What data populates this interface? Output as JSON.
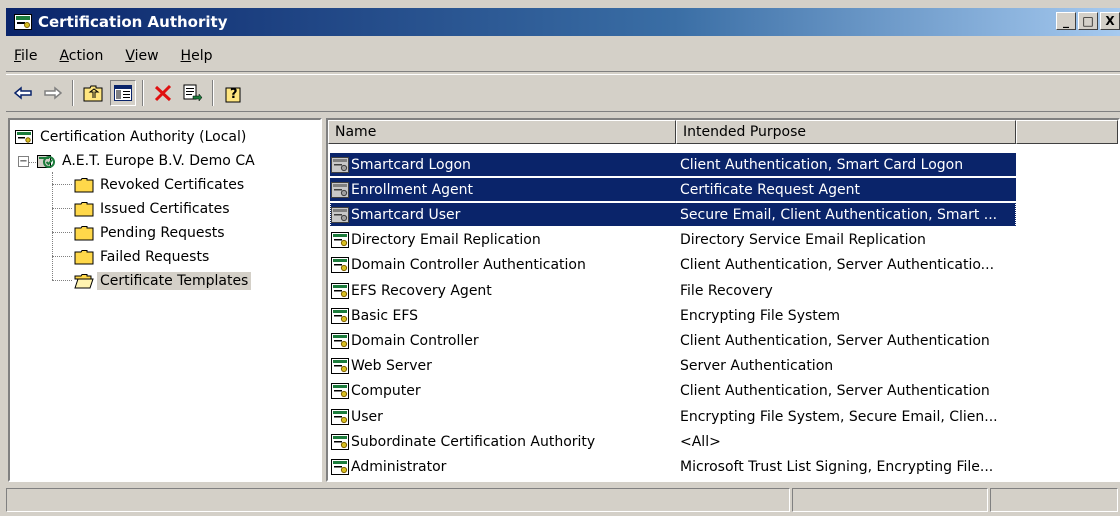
{
  "window": {
    "title": "Certification Authority",
    "caption": {
      "minimize": "_",
      "maximize": "□",
      "close": "X"
    }
  },
  "menu": [
    {
      "accel": "F",
      "rest": "ile"
    },
    {
      "accel": "A",
      "rest": "ction"
    },
    {
      "accel": "V",
      "rest": "iew"
    },
    {
      "accel": "H",
      "rest": "elp"
    }
  ],
  "toolbar": {
    "buttons": [
      "back-arrow-icon",
      "forward-arrow-icon",
      "up-one-level-icon",
      "show-hide-console-tree-icon",
      "delete-icon",
      "export-list-icon",
      "help-icon"
    ]
  },
  "tree": {
    "root": "Certification Authority (Local)",
    "ca": "A.E.T. Europe B.V. Demo CA",
    "folders": [
      "Revoked Certificates",
      "Issued Certificates",
      "Pending Requests",
      "Failed Requests",
      "Certificate Templates"
    ],
    "selected_folder": "Certificate Templates"
  },
  "list": {
    "columns": [
      "Name",
      "Intended Purpose"
    ],
    "rows": [
      {
        "name": "Smartcard Logon",
        "purpose": "Client Authentication, Smart Card Logon",
        "selected": true,
        "icon": "template-icon-grey"
      },
      {
        "name": "Enrollment Agent",
        "purpose": "Certificate Request Agent",
        "selected": true,
        "icon": "template-icon-grey"
      },
      {
        "name": "Smartcard User",
        "purpose": "Secure Email, Client Authentication, Smart ...",
        "selected": true,
        "focused": true,
        "icon": "template-icon-grey"
      },
      {
        "name": "Directory Email Replication",
        "purpose": "Directory Service Email Replication",
        "icon": "template-icon"
      },
      {
        "name": "Domain Controller Authentication",
        "purpose": "Client Authentication, Server Authenticatio...",
        "icon": "template-icon"
      },
      {
        "name": "EFS Recovery Agent",
        "purpose": "File Recovery",
        "icon": "template-icon"
      },
      {
        "name": "Basic EFS",
        "purpose": "Encrypting File System",
        "icon": "template-icon"
      },
      {
        "name": "Domain Controller",
        "purpose": "Client Authentication, Server Authentication",
        "icon": "template-icon"
      },
      {
        "name": "Web Server",
        "purpose": "Server Authentication",
        "icon": "template-icon"
      },
      {
        "name": "Computer",
        "purpose": "Client Authentication, Server Authentication",
        "icon": "template-icon"
      },
      {
        "name": "User",
        "purpose": "Encrypting File System, Secure Email, Clien...",
        "icon": "template-icon"
      },
      {
        "name": "Subordinate Certification Authority",
        "purpose": "<All>",
        "icon": "template-icon"
      },
      {
        "name": "Administrator",
        "purpose": "Microsoft Trust List Signing, Encrypting File...",
        "icon": "template-icon"
      }
    ]
  },
  "colors": {
    "selection": "#0a246a",
    "chrome": "#d4d0c8",
    "folder": "#ffd84a"
  }
}
